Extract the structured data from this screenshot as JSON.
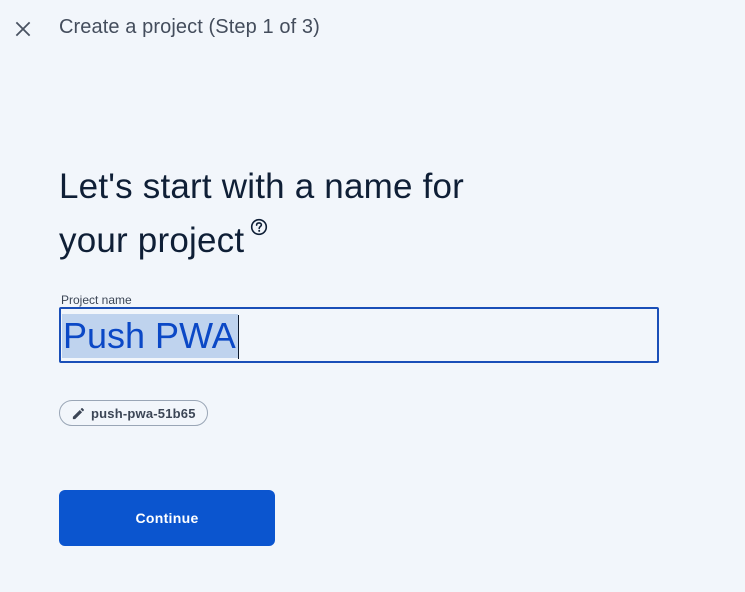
{
  "header": {
    "step_title": "Create a project (Step 1 of 3)",
    "close_icon": "close-icon"
  },
  "main": {
    "heading_line1": "Let's start with a name for",
    "heading_line2": "your project",
    "help_icon": "help-circle-icon",
    "project_name": {
      "label": "Project name",
      "value": "Push PWA"
    },
    "project_id_chip": {
      "icon": "pencil-icon",
      "label": "push-pwa-51b65"
    },
    "continue_label": "Continue"
  },
  "colors": {
    "background": "#f2f6fb",
    "primary": "#0b55cf",
    "input_border": "#1a4fb8",
    "selection": "#bfd3ee",
    "heading_text": "#0f1f36"
  }
}
